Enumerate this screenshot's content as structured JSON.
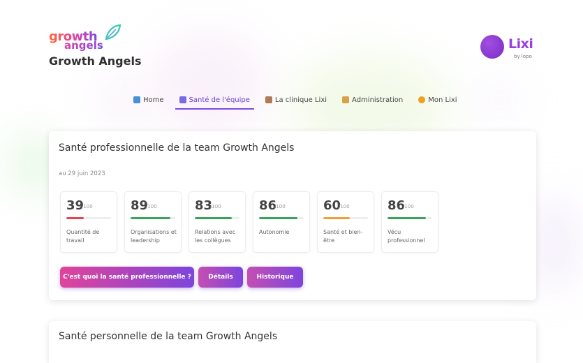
{
  "brand": {
    "logo_word1": "growth",
    "logo_word2": "angels",
    "name": "Growth Angels"
  },
  "lixi": {
    "word": "Lixi",
    "tagline": "by lopo"
  },
  "nav": {
    "items": [
      {
        "label": "Home",
        "icon": "home-icon",
        "color": "#4a90d9"
      },
      {
        "label": "Santé de l'équipe",
        "icon": "health-icon",
        "color": "#7b6be0",
        "active": true
      },
      {
        "label": "La clinique Lixi",
        "icon": "clinic-icon",
        "color": "#b07a5a"
      },
      {
        "label": "Administration",
        "icon": "admin-icon",
        "color": "#d8a24a"
      },
      {
        "label": "Mon Lixi",
        "icon": "lixi-icon",
        "color": "#f0a020"
      }
    ]
  },
  "professional": {
    "title": "Santé professionnelle de la team Growth Angels",
    "date": "au 29 juin 2023",
    "metrics": [
      {
        "score": "39",
        "unit": "/100",
        "value": 39,
        "color": "#e8434f",
        "label": "Quantité de travail"
      },
      {
        "score": "89",
        "unit": "/100",
        "value": 89,
        "color": "#3aa35a",
        "label": "Organisations et leadership"
      },
      {
        "score": "83",
        "unit": "/100",
        "value": 83,
        "color": "#3aa35a",
        "label": "Relations avec les collègues"
      },
      {
        "score": "86",
        "unit": "/100",
        "value": 86,
        "color": "#3aa35a",
        "label": "Autonomie"
      },
      {
        "score": "60",
        "unit": "/100",
        "value": 60,
        "color": "#f0a030",
        "label": "Santé et bien-être"
      },
      {
        "score": "86",
        "unit": "/100",
        "value": 86,
        "color": "#3aa35a",
        "label": "Vécu professionnel"
      }
    ],
    "buttons": {
      "main": "C'est quoi la santé professionnelle ?",
      "details": "Détails",
      "history": "Historique"
    }
  },
  "personal": {
    "title": "Santé personnelle de la team Growth Angels"
  },
  "colors": {
    "accent": "#7c4ce0",
    "gradient_start": "#e0449a",
    "gradient_end": "#7d45dd"
  }
}
